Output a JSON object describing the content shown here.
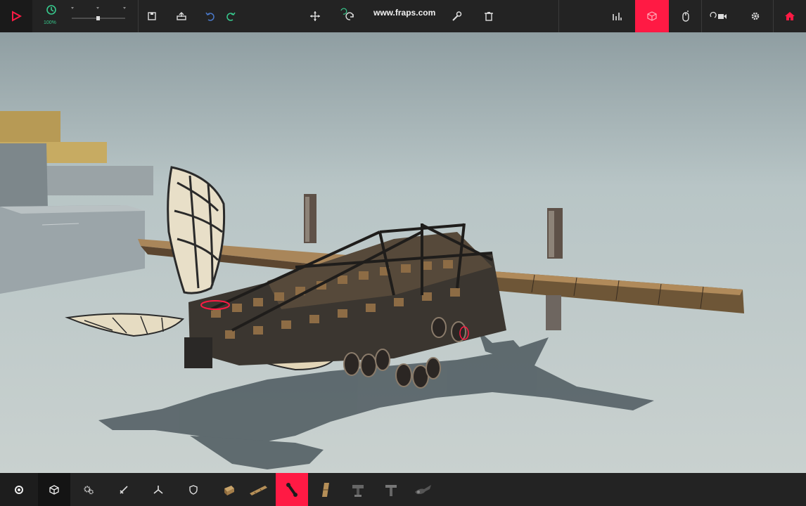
{
  "toolbar": {
    "speed_label": "100%",
    "watermark": "www.fraps.com"
  },
  "icons": {
    "play": "play-icon",
    "clock": "clock-icon",
    "save": "save-icon",
    "load": "load-icon",
    "undo": "undo-icon",
    "redo": "redo-icon",
    "move": "move-icon",
    "rotate": "rotate-icon",
    "wrench": "wrench-icon",
    "trash": "trash-icon",
    "stats": "stats-icon",
    "cube": "cube-icon",
    "mouse": "mouse-icon",
    "camera": "camera-icon",
    "settings": "gear-icon",
    "home": "home-icon"
  },
  "colors": {
    "bar": "#232323",
    "accent": "#ff1a44",
    "speed": "#37c98d"
  },
  "categories": [
    "basic",
    "blocks",
    "mechanical",
    "weaponry",
    "flight",
    "armour"
  ],
  "parts_selected": 2
}
